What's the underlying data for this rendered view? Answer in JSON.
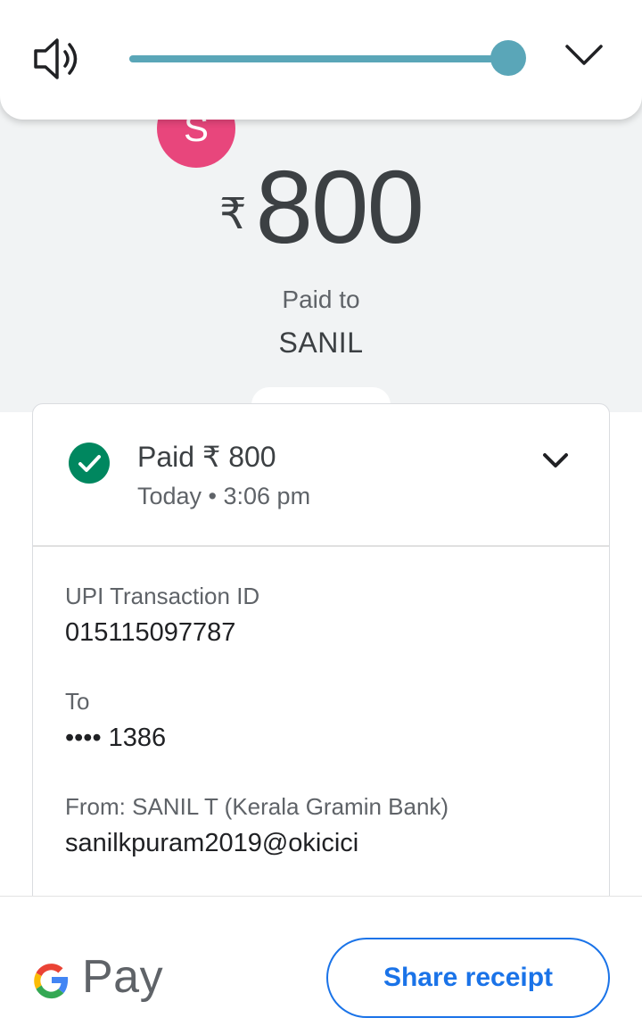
{
  "volume": {
    "level": 0.96,
    "accent": "#5aa6b8"
  },
  "payee": {
    "initial": "S",
    "avatar_color": "#e8467c",
    "name": "SANIL"
  },
  "hero": {
    "currency": "₹",
    "amount": "800",
    "paid_to_label": "Paid to"
  },
  "status": {
    "title": "Paid ₹ 800",
    "subtitle": "Today • 3:06 pm",
    "icon": "check-circle-icon",
    "color": "#00875f"
  },
  "details": {
    "upi_label": "UPI Transaction ID",
    "upi_value": "015115097787",
    "to_label": "To",
    "to_value": "•••• 1386",
    "from_label": "From: SANIL T (Kerala Gramin Bank)",
    "from_value": "sanilkpuram2019@okicici"
  },
  "footer": {
    "logo_text": "Pay",
    "share_label": "Share receipt",
    "share_color": "#1a73e8"
  }
}
